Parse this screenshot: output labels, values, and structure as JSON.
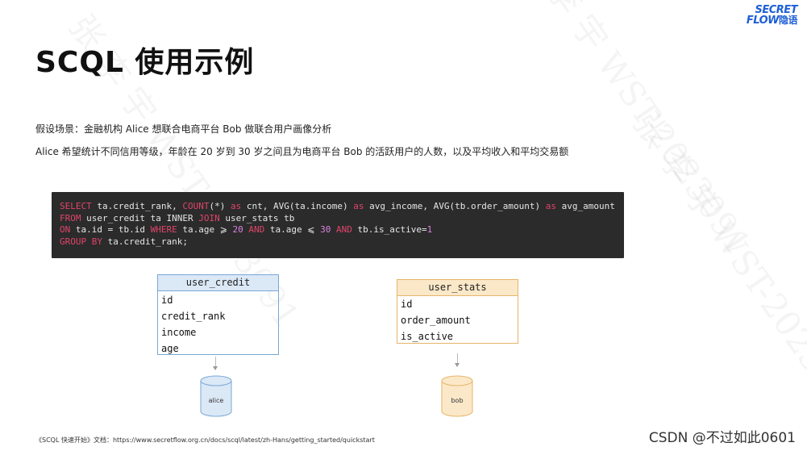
{
  "logo": {
    "line1": "SECRET",
    "line2": "FLOW",
    "line2_cn": "隐语"
  },
  "title": "SCQL 使用示例",
  "description": {
    "line1": "假设场景：金融机构 Alice 想联合电商平台 Bob 做联合用户画像分析",
    "line2": "Alice 希望统计不同信用等级，年龄在 20 岁到 30 岁之间且为电商平台 Bob 的活跃用户的人数，以及平均收入和平均交易额"
  },
  "code": {
    "lines": [
      [
        [
          "kw",
          "SELECT"
        ],
        [
          "t",
          " ta.credit_rank, "
        ],
        [
          "kw",
          "COUNT"
        ],
        [
          "t",
          "(*) "
        ],
        [
          "kw",
          "as"
        ],
        [
          "t",
          " cnt, AVG(ta.income) "
        ],
        [
          "kw",
          "as"
        ],
        [
          "t",
          " avg_income, AVG(tb.order_amount) "
        ],
        [
          "kw",
          "as"
        ],
        [
          "t",
          " avg_amount"
        ]
      ],
      [
        [
          "kw",
          "FROM"
        ],
        [
          "t",
          " user_credit ta INNER "
        ],
        [
          "kw",
          "JOIN"
        ],
        [
          "t",
          " user_stats tb"
        ]
      ],
      [
        [
          "kw",
          "ON"
        ],
        [
          "t",
          " ta.id = tb.id "
        ],
        [
          "kw",
          "WHERE"
        ],
        [
          "t",
          " ta.age ⩾ "
        ],
        [
          "num",
          "20"
        ],
        [
          "t",
          " "
        ],
        [
          "kw",
          "AND"
        ],
        [
          "t",
          " ta.age ⩽ "
        ],
        [
          "num",
          "30"
        ],
        [
          "t",
          " "
        ],
        [
          "kw",
          "AND"
        ],
        [
          "t",
          " tb.is_active="
        ],
        [
          "num",
          "1"
        ]
      ],
      [
        [
          "kw",
          "GROUP BY"
        ],
        [
          "t",
          " ta.credit_rank;"
        ]
      ]
    ]
  },
  "tables": {
    "user_credit": {
      "name": "user_credit",
      "columns": [
        "id",
        "credit_rank",
        "income",
        "age"
      ],
      "db": "alice"
    },
    "user_stats": {
      "name": "user_stats",
      "columns": [
        "id",
        "order_amount",
        "is_active"
      ],
      "db": "bob"
    }
  },
  "footer": "《SCQL 快速开始》文档：https://www.secretflow.org.cn/docs/scql/latest/zh-Hans/getting_started/quickstart",
  "csdn": "CSDN @不过如此0601",
  "colors": {
    "code_bg": "#2b2b2b",
    "keyword": "#e0446a",
    "number": "#d882e0",
    "alice": "#dbe8f6",
    "bob": "#fbe8c8"
  }
}
